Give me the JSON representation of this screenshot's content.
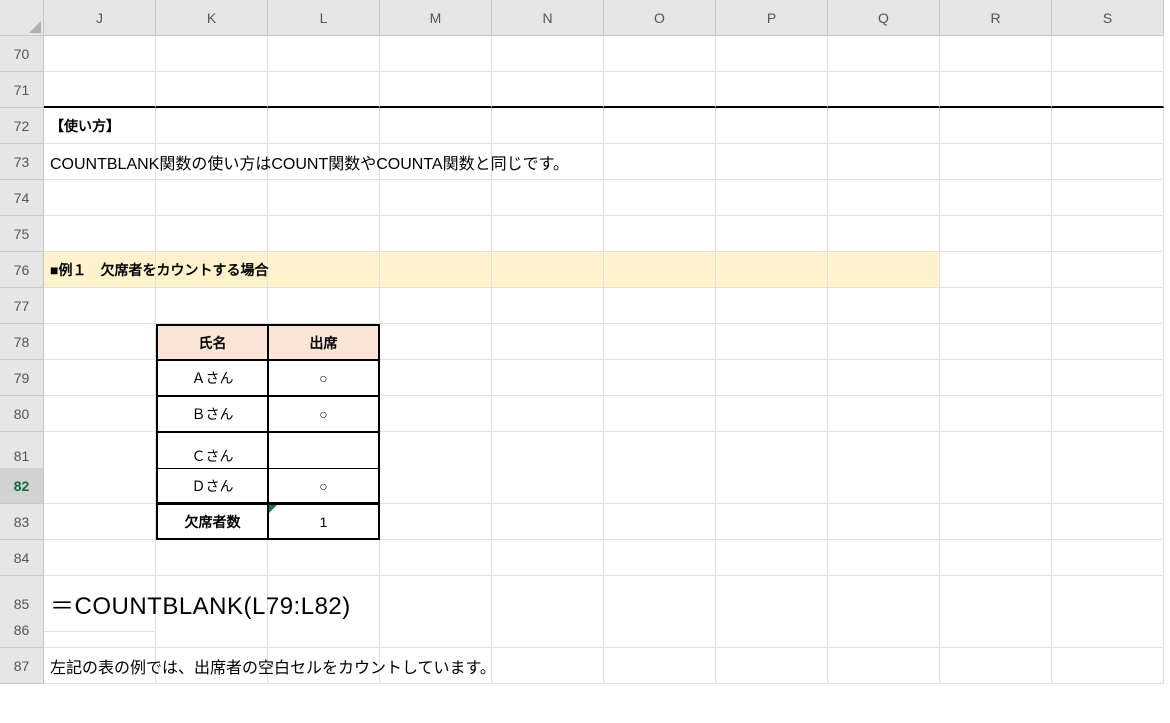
{
  "columns": [
    "J",
    "K",
    "L",
    "M",
    "N",
    "O",
    "P",
    "Q",
    "R",
    "S"
  ],
  "rows": [
    "70",
    "71",
    "72",
    "73",
    "74",
    "75",
    "76",
    "77",
    "78",
    "79",
    "80",
    "81",
    "82",
    "83",
    "84",
    "85",
    "86",
    "87"
  ],
  "selectedRow": "82",
  "content": {
    "r72_title": "【使い方】",
    "r73_text": "COUNTBLANK関数の使い方はCOUNT関数やCOUNTA関数と同じです。",
    "r76_text": "■例１　欠席者をカウントする場合",
    "table": {
      "header_name": "氏名",
      "header_attend": "出席",
      "rows": [
        {
          "name": "Ａさん",
          "attend": "○"
        },
        {
          "name": "Ｂさん",
          "attend": "○"
        },
        {
          "name": "Ｃさん",
          "attend": ""
        },
        {
          "name": "Ｄさん",
          "attend": "○"
        }
      ],
      "footer_label": "欠席者数",
      "footer_value": "1"
    },
    "r85_formula": "＝COUNTBLANK(L79:L82)",
    "r87_text": "左記の表の例では、出席者の空白セルをカウントしています。"
  },
  "chart_data": {
    "type": "table",
    "title": "欠席者をカウントする場合",
    "columns": [
      "氏名",
      "出席"
    ],
    "rows": [
      [
        "Ａさん",
        "○"
      ],
      [
        "Ｂさん",
        "○"
      ],
      [
        "Ｃさん",
        ""
      ],
      [
        "Ｄさん",
        "○"
      ]
    ],
    "summary": {
      "label": "欠席者数",
      "value": 1
    },
    "formula": "=COUNTBLANK(L79:L82)"
  }
}
